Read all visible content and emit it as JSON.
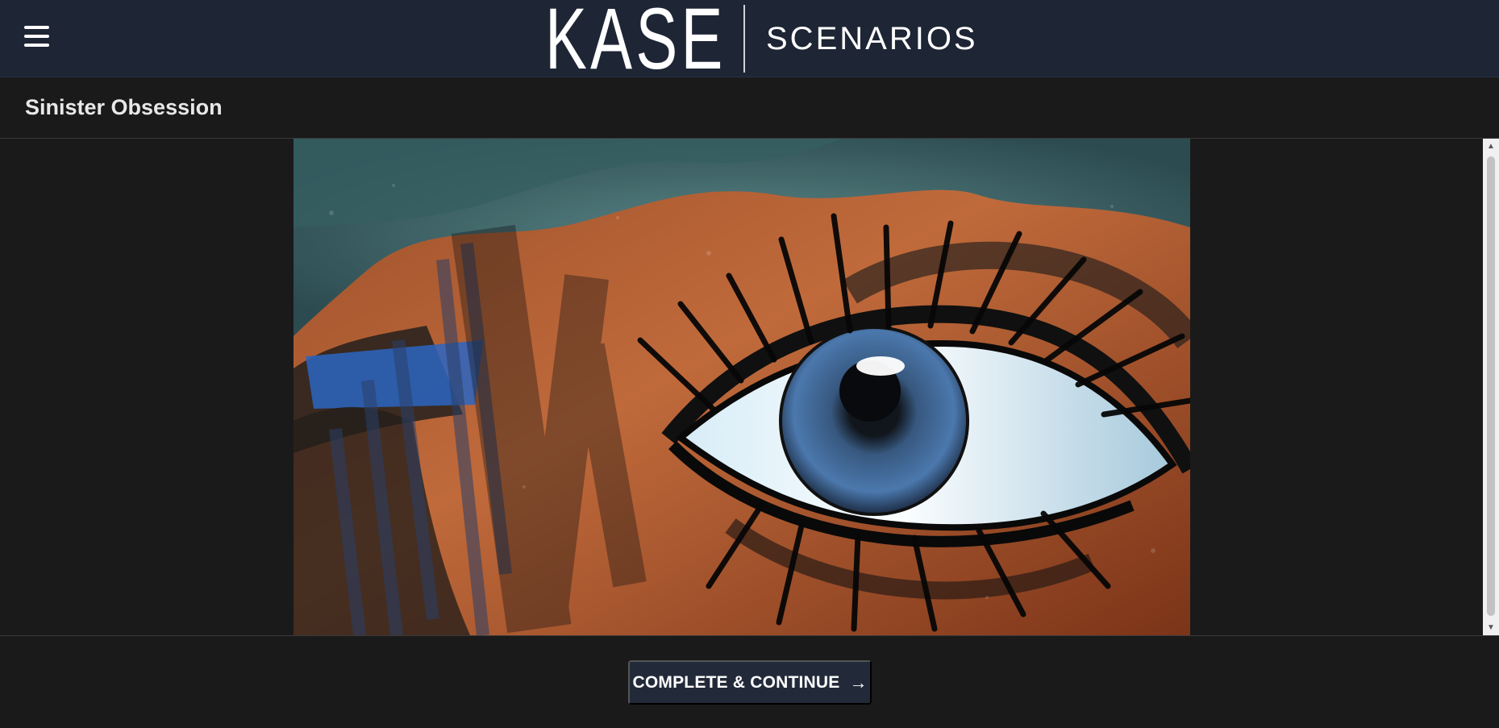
{
  "header": {
    "brand_name": "KASE",
    "brand_sub": "SCENARIOS",
    "menu_icon": "hamburger-menu-icon"
  },
  "page": {
    "title": "Sinister Obsession"
  },
  "media": {
    "image_description_icon": "eye-illustration",
    "colors": {
      "teal": "#4a7677",
      "orange": "#b9643a",
      "iris": "#3e6aa1",
      "dark": "#1a1a1a"
    }
  },
  "footer": {
    "cta_label": "COMPLETE & CONTINUE",
    "cta_icon": "arrow-right-icon",
    "cta_arrow": "→"
  },
  "colors": {
    "topbar_bg": "#1e2535",
    "page_bg": "#1a1a1a",
    "button_bg": "#222a3a"
  }
}
